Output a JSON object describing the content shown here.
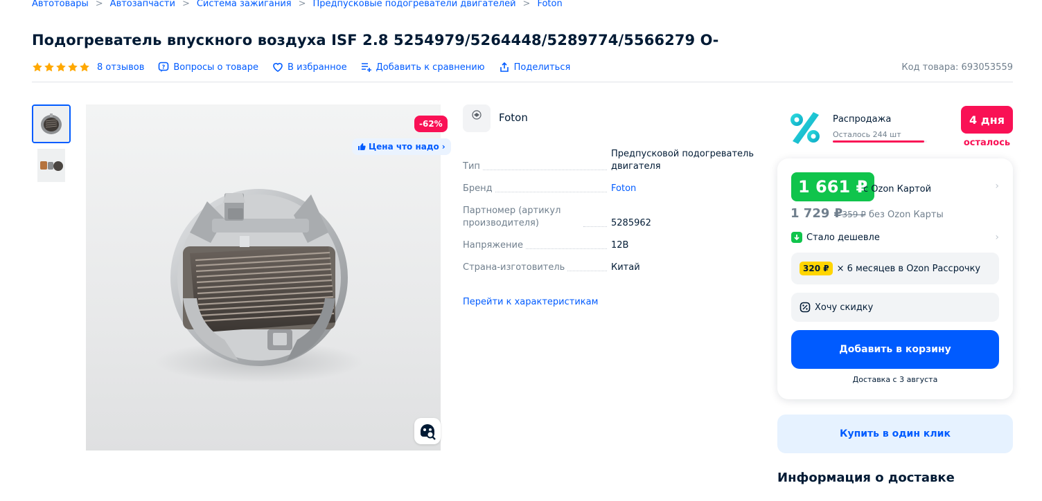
{
  "breadcrumbs": [
    "Автотовары",
    "Автозапчасти",
    "Система зажигания",
    "Предпусковые подогреватели двигателей",
    "Foton"
  ],
  "product": {
    "title": "Подогреватель впускного воздуха ISF 2.8 5254979/5264448/5289774/5566279 О-",
    "rating_stars": 5,
    "reviews": "8 отзывов",
    "questions": "Вопросы о товаре",
    "favorite": "В избранное",
    "compare": "Добавить к сравнению",
    "share": "Поделиться",
    "sku": "Код товара: 693053559"
  },
  "gallery": {
    "discount_badge": "-62%",
    "price_badge": "Цена что надо",
    "price_badge_chevron": "›",
    "lens_icon": "image-search-icon"
  },
  "brand": {
    "name": "Foton",
    "logo_text": "FOTON"
  },
  "specs": [
    {
      "key": "Тип",
      "value": "Предпусковой подогреватель двигателя",
      "link": false
    },
    {
      "key": "Бренд",
      "value": "Foton",
      "link": true
    },
    {
      "key": "Партномер (артикул производителя)",
      "value": "5285962",
      "link": false
    },
    {
      "key": "Напряжение",
      "value": "12В",
      "link": false
    },
    {
      "key": "Страна-изготовитель",
      "value": "Китай",
      "link": false
    }
  ],
  "specs_link": "Перейти к характеристикам",
  "sale": {
    "title": "Распродажа",
    "remaining": "Осталось 244 шт",
    "progress": 0.97,
    "days_value": "4 дня",
    "days_label": "осталось"
  },
  "price": {
    "ozon_card_price": "1 661 ₽",
    "ozon_card_label": "с Ozon Картой",
    "regular_price": "1 729 ₽",
    "old_price": "4 359 ₽",
    "no_card_label": "без Ozon Карты",
    "cheaper": "Стало дешевле",
    "installment_amount": "320 ₽",
    "installment_text": "× 6 месяцев в Ozon Рассрочку",
    "want_discount": "Хочу скидку",
    "add_to_cart": "Добавить в корзину",
    "delivery": "Доставка с 3 августа",
    "buy_one_click": "Купить в один клик",
    "chevron": "›"
  },
  "delivery_info_title": "Информация о доставке",
  "colors": {
    "accent": "#005bff",
    "discount": "#f91155",
    "ozon_green": "#10c44c",
    "star": "#ffa800",
    "installment_badge": "#ffd500"
  }
}
